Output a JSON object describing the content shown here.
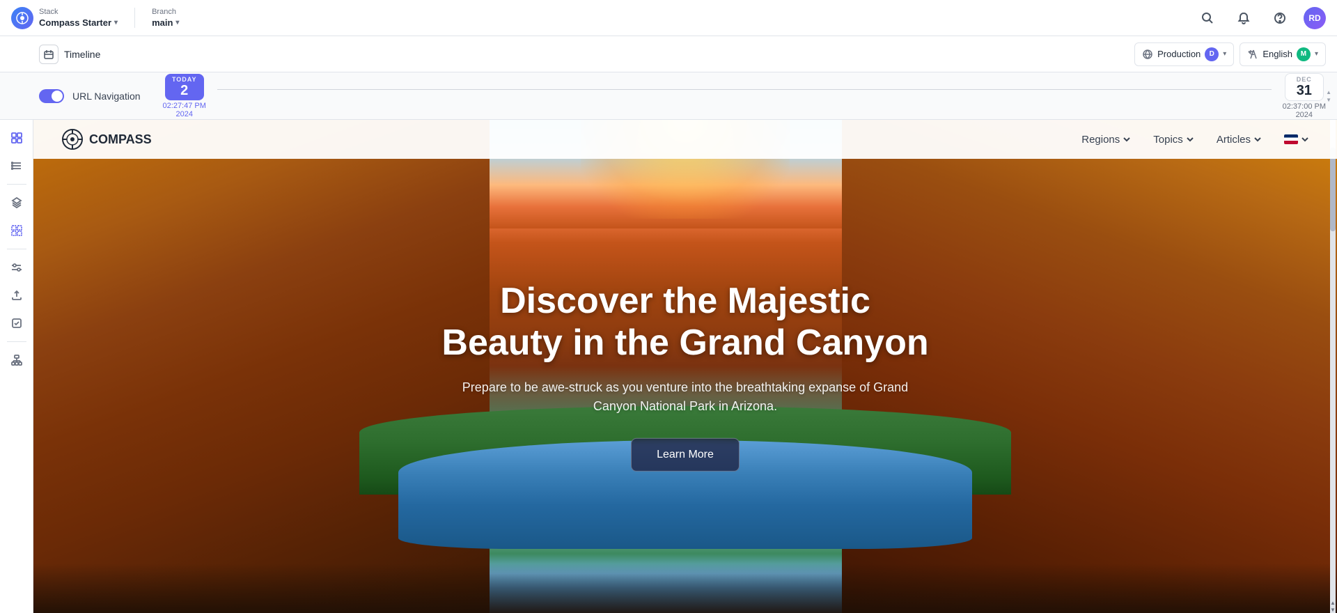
{
  "app": {
    "brand": {
      "stack_label": "Stack",
      "name": "Compass Starter",
      "chevron": "▾"
    },
    "branch": {
      "label": "Branch",
      "name": "main",
      "chevron": "▾"
    }
  },
  "topbar": {
    "search_icon": "🔍",
    "bell_icon": "🔔",
    "help_icon": "❓",
    "avatar_initials": "RD"
  },
  "second_bar": {
    "timeline_label": "Timeline",
    "environment": {
      "label": "Production",
      "badge": "D",
      "chevron": "▾"
    },
    "language": {
      "label": "English",
      "badge": "M",
      "chevron": "▾"
    }
  },
  "third_bar": {
    "toggle_on": true,
    "url_nav_label": "URL Navigation",
    "today_label": "TODAY",
    "today_date": "2",
    "today_time": "02:27:47 PM",
    "today_year": "2024",
    "right_month": "DEC",
    "right_date": "31",
    "right_time": "02:37:00 PM",
    "right_year": "2024"
  },
  "sidebar": {
    "items": [
      {
        "id": "grid",
        "icon": "⊞",
        "active": false
      },
      {
        "id": "list",
        "icon": "☰",
        "active": false
      },
      {
        "id": "layers",
        "icon": "◫",
        "active": false
      },
      {
        "id": "target",
        "icon": "⊕",
        "active": true
      },
      {
        "id": "controls",
        "icon": "⋮⋮",
        "active": false
      },
      {
        "id": "upload",
        "icon": "⬆",
        "active": false
      },
      {
        "id": "checklist",
        "icon": "☑",
        "active": false
      },
      {
        "id": "hierarchy",
        "icon": "⧉",
        "active": false
      }
    ]
  },
  "website": {
    "logo_text": "COMPASS",
    "nav_links": [
      {
        "label": "Regions",
        "has_chevron": true
      },
      {
        "label": "Topics",
        "has_chevron": true
      },
      {
        "label": "Articles",
        "has_chevron": true
      }
    ],
    "hero": {
      "title": "Discover the Majestic Beauty in the Grand Canyon",
      "subtitle": "Prepare to be awe-struck as you venture into the breathtaking expanse of Grand Canyon National Park in Arizona.",
      "cta_label": "Learn More"
    }
  }
}
